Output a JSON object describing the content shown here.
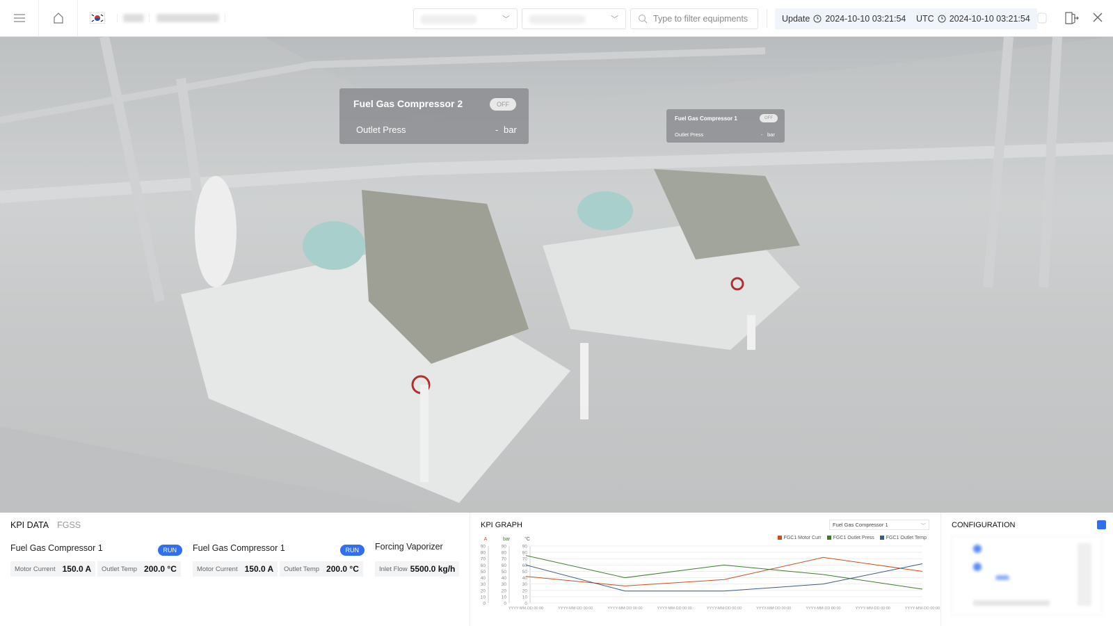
{
  "header": {
    "search_placeholder": "Type to filter equipments",
    "update_label": "Update",
    "update_time": "2024-10-10 03:21:54",
    "utc_label": "UTC",
    "utc_time": "2024-10-10 03:21:54"
  },
  "scene": {
    "tag_large": {
      "name": "Fuel Gas Compressor 2",
      "state": "OFF",
      "metric": "Outlet Press",
      "value": "-",
      "unit": "bar"
    },
    "tag_small": {
      "name": "Fuel Gas Compressor 1",
      "state": "OFF",
      "metric": "Outlet Press",
      "value": "-",
      "unit": "bar"
    }
  },
  "kpi_data": {
    "title": "KPI DATA",
    "tab": "FGSS",
    "equipments": [
      {
        "name": "Fuel Gas Compressor 1",
        "status": "RUN",
        "k1": "Motor Current",
        "v1": "150.0 A",
        "k2": "Outlet Temp",
        "v2": "200.0 °C"
      },
      {
        "name": "Fuel Gas Compressor 1",
        "status": "RUN",
        "k1": "Motor Current",
        "v1": "150.0 A",
        "k2": "Outlet Temp",
        "v2": "200.0 °C"
      },
      {
        "name": "Forcing Vaporizer",
        "k1": "Inlet Flow",
        "v1": "5500.0 kg/h"
      }
    ]
  },
  "kpi_graph": {
    "title": "KPI GRAPH",
    "selected": "Fuel Gas Compressor 1"
  },
  "configuration": {
    "title": "CONFIGURATION"
  },
  "chart_data": {
    "type": "line",
    "axes_units": [
      "A",
      "bar",
      "°C"
    ],
    "yticks": [
      0,
      10,
      20,
      30,
      40,
      50,
      60,
      70,
      80,
      90
    ],
    "ylim": [
      0,
      90
    ],
    "xticks": [
      "YYYY-MM-DD 00:00",
      "YYYY-MM-DD 00:00",
      "YYYY-MM-DD 00:00",
      "YYYY-MM-DD 00:00",
      "YYYY-MM-DD 00:00",
      "YYYY-MM-DD 00:00",
      "YYYY-MM-DD 00:00",
      "YYYY-MM-DD 00:00",
      "YYYY-MM-DD 00:00"
    ],
    "legend_position": "top-right",
    "series": [
      {
        "name": "FGC1 Motor Curr",
        "color": "#c8501e",
        "values": [
          42,
          27,
          37,
          72,
          50
        ]
      },
      {
        "name": "FGC1 Outlet Press",
        "color": "#3f7a2c",
        "values": [
          75,
          40,
          60,
          45,
          22
        ]
      },
      {
        "name": "FGC1 Outlet Temp",
        "color": "#3d5a80",
        "values": [
          60,
          19,
          19,
          30,
          62
        ]
      }
    ]
  }
}
